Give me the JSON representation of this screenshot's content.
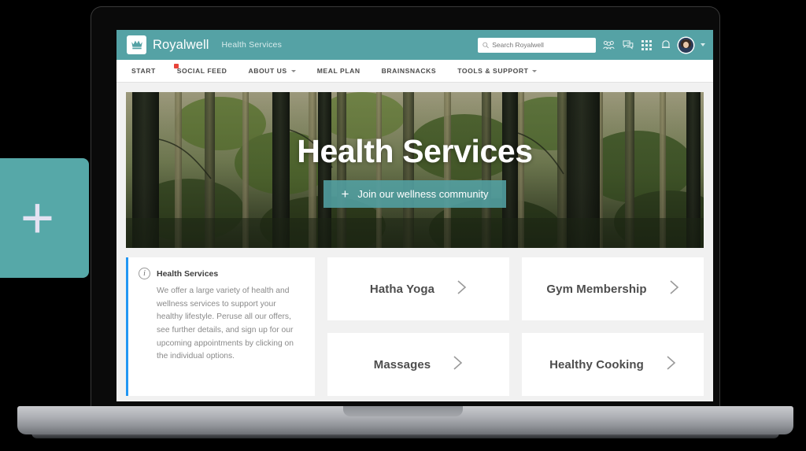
{
  "badge": {
    "icon": "plus-icon",
    "symbol": "+"
  },
  "header": {
    "logo_icon": "crown-icon",
    "brand": "Royalwell",
    "section": "Health Services",
    "search": {
      "placeholder": "Search Royalwell",
      "value": "",
      "icon": "search-icon"
    },
    "icons": [
      {
        "name": "people-group-icon"
      },
      {
        "name": "chat-bubble-icon"
      },
      {
        "name": "apps-grid-icon"
      },
      {
        "name": "bell-notification-icon"
      }
    ],
    "avatar": {
      "name": "user-avatar",
      "caret": "chevron-down-icon"
    }
  },
  "nav": {
    "items": [
      {
        "label": "START",
        "has_caret": false,
        "has_dot": false
      },
      {
        "label": "SOCIAL FEED",
        "has_caret": false,
        "has_dot": true
      },
      {
        "label": "ABOUT US",
        "has_caret": true,
        "has_dot": false
      },
      {
        "label": "MEAL PLAN",
        "has_caret": false,
        "has_dot": false
      },
      {
        "label": "BRAINSNACKS",
        "has_caret": false,
        "has_dot": false
      },
      {
        "label": "TOOLS & SUPPORT",
        "has_caret": true,
        "has_dot": false
      }
    ]
  },
  "hero": {
    "title": "Health Services",
    "cta_label": "Join our wellness community",
    "cta_icon": "plus-icon",
    "background": "forest-photo"
  },
  "info_card": {
    "icon": "info-icon",
    "title": "Health Services",
    "body": "We offer a large variety of health and wellness services to support your healthy lifestyle. Peruse all our offers, see further details, and sign up for our upcoming appointments by clicking on the individual options.",
    "accent_color": "#2196f3"
  },
  "services": [
    {
      "label": "Hatha Yoga",
      "icon": "chevron-right-icon"
    },
    {
      "label": "Gym Membership",
      "icon": "chevron-right-icon"
    },
    {
      "label": "Massages",
      "icon": "chevron-right-icon"
    },
    {
      "label": "Healthy Cooking",
      "icon": "chevron-right-icon"
    }
  ],
  "colors": {
    "brand_teal": "#55a2a5",
    "badge_teal": "#56a8a8",
    "accent_blue": "#2196f3",
    "notification_red": "#e8443a",
    "page_bg": "#f1f1f1"
  }
}
